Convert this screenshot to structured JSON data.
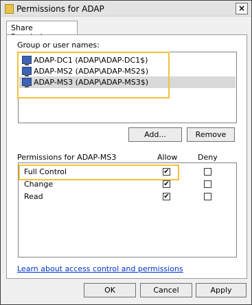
{
  "window": {
    "title": "Permissions for ADAP",
    "close_glyph": "×"
  },
  "tab": {
    "label": "Share Permissions"
  },
  "group_section": {
    "label": "Group or user names:",
    "users": [
      {
        "name": "ADAP-DC1 (ADAP\\ADAP-DC1$)",
        "selected": false
      },
      {
        "name": "ADAP-MS2 (ADAP\\ADAP-MS2$)",
        "selected": false
      },
      {
        "name": "ADAP-MS3 (ADAP\\ADAP-MS3$)",
        "selected": true
      }
    ],
    "add_label": "Add...",
    "remove_label": "Remove"
  },
  "permissions_section": {
    "label": "Permissions for ADAP-MS3",
    "allow_header": "Allow",
    "deny_header": "Deny",
    "rows": [
      {
        "name": "Full Control",
        "allow": true,
        "deny": false
      },
      {
        "name": "Change",
        "allow": true,
        "deny": false
      },
      {
        "name": "Read",
        "allow": true,
        "deny": false
      }
    ]
  },
  "help_link": "Learn about access control and permissions",
  "footer": {
    "ok_label": "OK",
    "cancel_label": "Cancel",
    "apply_label": "Apply"
  },
  "colors": {
    "highlight": "#f2c23a",
    "selection": "#d9d9d9",
    "link": "#0033cc"
  },
  "icons": {
    "user": "computer-icon",
    "window": "folder-icon",
    "check": "✔"
  }
}
